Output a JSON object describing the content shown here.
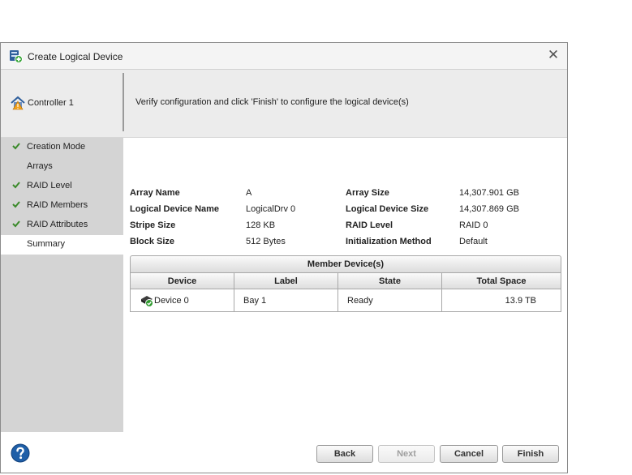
{
  "dialog": {
    "title": "Create Logical Device",
    "close_glyph": "✕"
  },
  "header": {
    "controller_label": "Controller 1",
    "instruction": "Verify configuration and click 'Finish' to configure the logical device(s)"
  },
  "nav": {
    "items": [
      {
        "label": "Creation Mode",
        "checked": true
      },
      {
        "label": "Arrays",
        "checked": false
      },
      {
        "label": "RAID Level",
        "checked": true
      },
      {
        "label": "RAID Members",
        "checked": true
      },
      {
        "label": "RAID Attributes",
        "checked": true
      },
      {
        "label": "Summary",
        "checked": false,
        "active": true
      }
    ]
  },
  "summary": {
    "left": [
      {
        "label": "Array Name",
        "value": "A"
      },
      {
        "label": "Logical Device Name",
        "value": "LogicalDrv 0"
      },
      {
        "label": "Stripe Size",
        "value": "128 KB"
      },
      {
        "label": "Block Size",
        "value": "512 Bytes"
      }
    ],
    "right": [
      {
        "label": "Array Size",
        "value": "14,307.901 GB"
      },
      {
        "label": "Logical Device Size",
        "value": "14,307.869 GB"
      },
      {
        "label": "RAID Level",
        "value": "RAID 0"
      },
      {
        "label": "Initialization Method",
        "value": "Default"
      }
    ]
  },
  "members": {
    "title": "Member Device(s)",
    "columns": [
      "Device",
      "Label",
      "State",
      "Total Space"
    ],
    "rows": [
      {
        "device": "Device 0",
        "label": "Bay 1",
        "state": "Ready",
        "total_space": "13.9 TB"
      }
    ]
  },
  "footer": {
    "back_label": "Back",
    "next_label": "Next",
    "cancel_label": "Cancel",
    "finish_label": "Finish"
  },
  "colors": {
    "check_green": "#3a8a2a",
    "help_blue": "#1f5fa8",
    "nav_bg": "#d4d4d4"
  }
}
